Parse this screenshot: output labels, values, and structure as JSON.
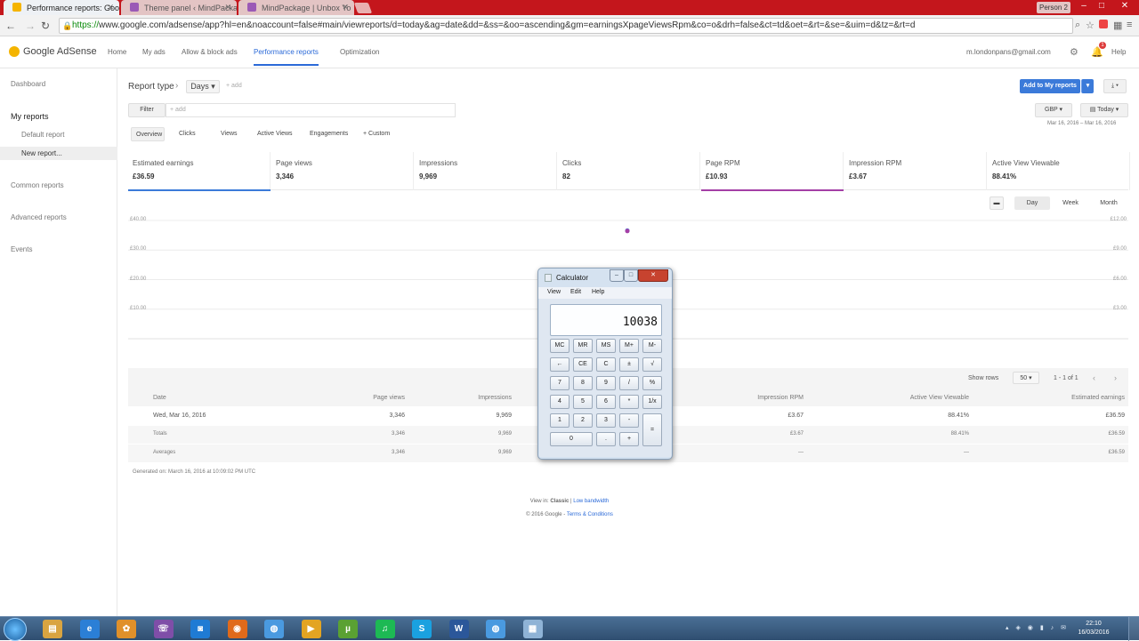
{
  "browser": {
    "tabs": [
      {
        "title": "Performance reports: Goo",
        "active": true
      },
      {
        "title": "Theme panel ‹ MindPackag",
        "active": false
      },
      {
        "title": "MindPackage | Unbox Yo",
        "active": false
      }
    ],
    "profile": "Person 2",
    "url_scheme": "https://",
    "url_rest": "www.google.com/adsense/app?hl=en&noaccount=false#main/viewreports/d=today&ag=date&dd=&ss=&oo=ascending&gm=earningsXpageViewsRpm&co=o&drh=false&ct=td&oet=&rt=&se=&uim=d&tz=&rt=d"
  },
  "app": {
    "brand": "Google AdSense",
    "nav": [
      "Home",
      "My ads",
      "Allow & block ads",
      "Performance reports",
      "Optimization"
    ],
    "active_nav": "Performance reports",
    "account": "m.londonpans@gmail.com",
    "notifications": "1",
    "help": "Help"
  },
  "sidebar": {
    "dashboard": "Dashboard",
    "my_reports": "My reports",
    "default_report": "Default report",
    "new_report": "New report...",
    "common_reports": "Common reports",
    "advanced_reports": "Advanced reports",
    "events": "Events"
  },
  "report": {
    "type_label": "Report type",
    "chevron": "›",
    "dimension": "Days",
    "add": "+ add",
    "filter_label": "Filter",
    "filter_placeholder": "+ add",
    "add_to_my_reports": "Add to My reports",
    "currency": "GBP",
    "date_range": "Today",
    "date_span": "Mar 16, 2016 – Mar 16, 2016",
    "tabs": [
      "Overview",
      "Clicks",
      "Views",
      "Active Views",
      "Engagements",
      "+ Custom"
    ],
    "active_tab": "Overview"
  },
  "metrics": [
    {
      "label": "Estimated earnings",
      "value": "£36.59",
      "color": "#3b7ad9"
    },
    {
      "label": "Page views",
      "value": "3,346",
      "color": ""
    },
    {
      "label": "Impressions",
      "value": "9,969",
      "color": ""
    },
    {
      "label": "Clicks",
      "value": "82",
      "color": ""
    },
    {
      "label": "Page RPM",
      "value": "£10.93",
      "color": "#a43fa6"
    },
    {
      "label": "Impression RPM",
      "value": "£3.67",
      "color": ""
    },
    {
      "label": "Active View Viewable",
      "value": "88.41%",
      "color": ""
    }
  ],
  "chart": {
    "range_buttons": [
      "Day",
      "Week",
      "Month"
    ],
    "active_range": "Day",
    "left_ticks": [
      "£40.00",
      "£30.00",
      "£20.00",
      "£10.00"
    ],
    "right_ticks": [
      "£12.00",
      "£9.00",
      "£6.00",
      "£3.00"
    ]
  },
  "chart_data": {
    "type": "scatter",
    "series": [
      {
        "name": "Estimated earnings",
        "color": "#3b7ad9",
        "axis": "left",
        "x": [
          "Wed, Mar 16, 2016"
        ],
        "y": [
          36.59
        ]
      },
      {
        "name": "Page RPM",
        "color": "#a43fa6",
        "axis": "right",
        "x": [
          "Wed, Mar 16, 2016"
        ],
        "y": [
          10.93
        ]
      }
    ],
    "ylim_left": [
      0,
      40
    ],
    "ylim_right": [
      0,
      12
    ],
    "grid": true
  },
  "table": {
    "show_rows_label": "Show rows",
    "show_rows_value": "50",
    "pager": "1 - 1 of 1",
    "columns": [
      "Date",
      "Page views",
      "Impressions",
      "Impression RPM",
      "Active View Viewable",
      "Estimated earnings"
    ],
    "rows": [
      [
        "Wed, Mar 16, 2016",
        "3,346",
        "9,969",
        "£3.67",
        "88.41%",
        "£36.59"
      ],
      [
        "Totals",
        "3,346",
        "9,969",
        "£3.67",
        "88.41%",
        "£36.59"
      ],
      [
        "Averages",
        "3,346",
        "9,969",
        "—",
        "—",
        "£36.59"
      ]
    ],
    "generated": "Generated on: March 16, 2016 at 10:09:02 PM UTC"
  },
  "footer": {
    "view_in": "View in:",
    "classic": "Classic",
    "sep": "|",
    "low_bandwidth": "Low bandwidth",
    "copyright": "© 2016 Google -",
    "terms": "Terms & Conditions"
  },
  "calculator": {
    "title": "Calculator",
    "menu": [
      "View",
      "Edit",
      "Help"
    ],
    "display": "10038",
    "keys": [
      [
        "MC",
        "MR",
        "MS",
        "M+",
        "M-"
      ],
      [
        "←",
        "CE",
        "C",
        "±",
        "√"
      ],
      [
        "7",
        "8",
        "9",
        "/",
        "%"
      ],
      [
        "4",
        "5",
        "6",
        "*",
        "1/x"
      ],
      [
        "1",
        "2",
        "3",
        "-",
        "="
      ],
      [
        "0",
        ".",
        "+"
      ]
    ]
  },
  "taskbar": {
    "apps": [
      "Files",
      "IE",
      "Paint",
      "Viber",
      "Skype-alt",
      "Firefox",
      "Chrome",
      "Media",
      "uTorrent",
      "Spotify",
      "Skype",
      "Word",
      "Chrome-2",
      "Calculator"
    ],
    "time": "22:10",
    "date": "16/03/2016"
  }
}
